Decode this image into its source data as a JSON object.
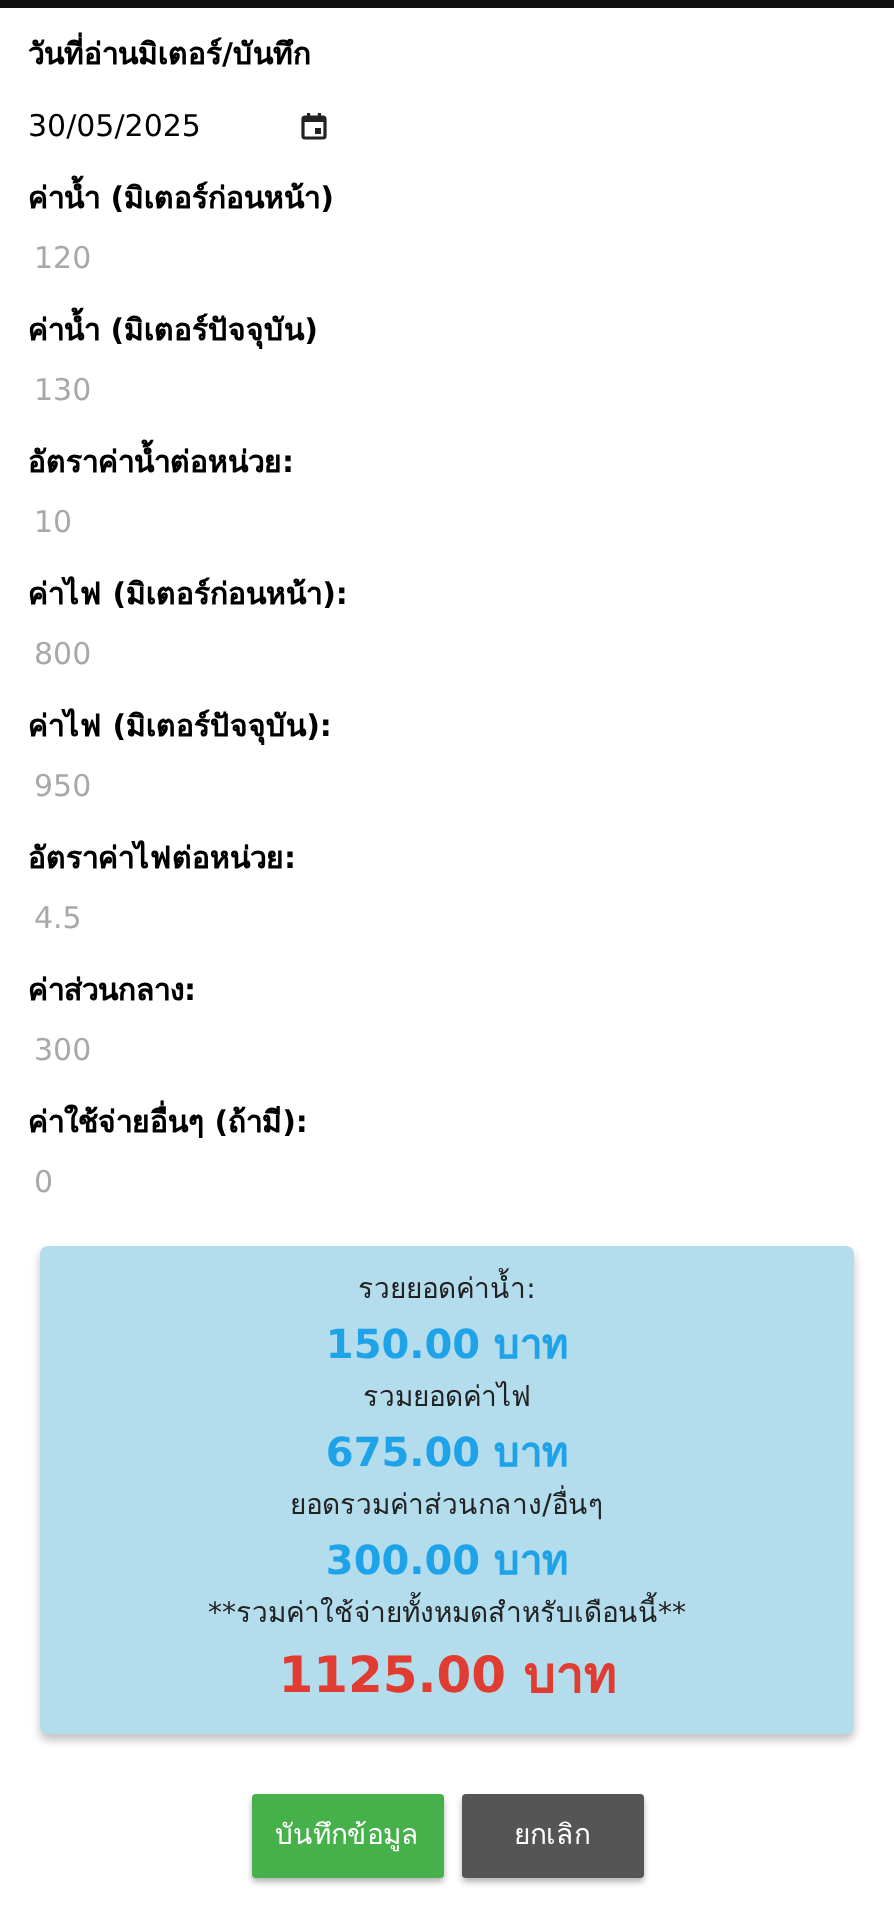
{
  "date_field": {
    "label": "วันที่อ่านมิเตอร์/บันทึก",
    "value": "30/05/2025"
  },
  "fields": [
    {
      "label": "ค่าน้ำ (มิเตอร์ก่อนหน้า)",
      "placeholder": "120"
    },
    {
      "label": "ค่าน้ำ (มิเตอร์ปัจจุบัน)",
      "placeholder": "130"
    },
    {
      "label": "อัตราค่าน้ำต่อหน่วย:",
      "placeholder": "10"
    },
    {
      "label": "ค่าไฟ (มิเตอร์ก่อนหน้า):",
      "placeholder": "800"
    },
    {
      "label": "ค่าไฟ (มิเตอร์ปัจจุบัน):",
      "placeholder": "950"
    },
    {
      "label": "อัตราค่าไฟต่อหน่วย:",
      "placeholder": "4.5"
    },
    {
      "label": "ค่าส่วนกลาง:",
      "placeholder": "300"
    },
    {
      "label": "ค่าใช้จ่ายอื่นๆ (ถ้ามี):",
      "placeholder": "0"
    }
  ],
  "summary": [
    {
      "kind": "label",
      "text": "รวยยอดค่าน้ำ:"
    },
    {
      "kind": "amount",
      "text": "150.00 บาท"
    },
    {
      "kind": "label",
      "text": "รวมยอดค่าไฟ"
    },
    {
      "kind": "amount",
      "text": "675.00 บาท"
    },
    {
      "kind": "label",
      "text": "ยอดรวมค่าส่วนกลาง/อื่นๆ"
    },
    {
      "kind": "amount",
      "text": "300.00 บาท"
    },
    {
      "kind": "label",
      "text": "**รวมค่าใช้จ่ายทั้งหมดสำหรับเดือนนี้**"
    },
    {
      "kind": "total",
      "text": "1125.00 บาท"
    }
  ],
  "buttons": [
    {
      "kind": "primary",
      "label": "บันทึกข้อมูล"
    },
    {
      "kind": "secondary",
      "label": "ยกเลิก"
    }
  ]
}
